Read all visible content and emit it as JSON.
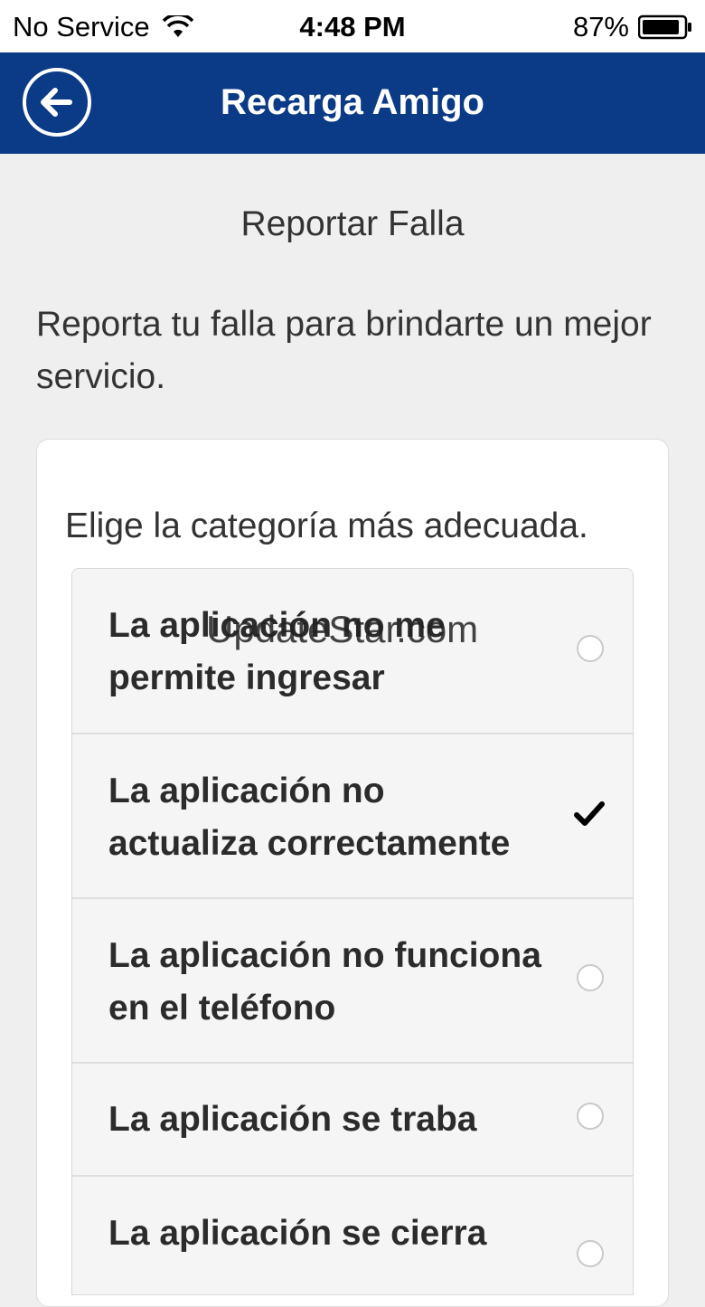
{
  "status_bar": {
    "carrier": "No Service",
    "time": "4:48 PM",
    "battery": "87%",
    "wifi_icon": "wifi-icon",
    "battery_icon": "battery-icon"
  },
  "nav": {
    "title": "Recarga Amigo",
    "back_icon": "back-arrow-icon",
    "color": "#0b3a86"
  },
  "page": {
    "heading": "Reportar Falla",
    "intro": "Reporta tu falla para brindarte un mejor servicio."
  },
  "card": {
    "prompt": "Elige la categoría más adecuada.",
    "options": [
      {
        "label": "La aplicación no me permite ingresar",
        "selected": false
      },
      {
        "label": "La aplicación no actualiza correctamente",
        "selected": true
      },
      {
        "label": "La aplicación no funciona en el teléfono",
        "selected": false
      },
      {
        "label": "La aplicación se traba",
        "selected": false
      },
      {
        "label": "La aplicación se cierra",
        "selected": false
      }
    ]
  },
  "watermark": "UpdateStar.com"
}
